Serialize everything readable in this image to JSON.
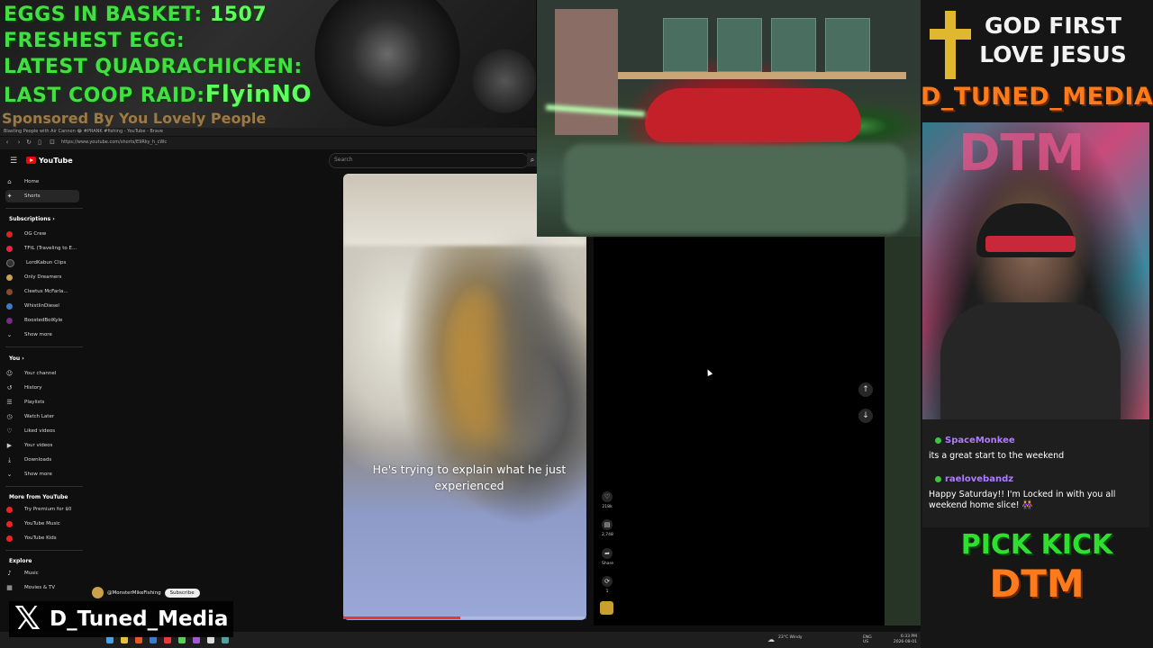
{
  "overlay": {
    "eggs_label": "EGGS IN BASKET:",
    "eggs_value": "1507",
    "freshest_label": "FRESHEST EGG:",
    "freshest_value": "",
    "quadrachicken_label": "LATEST QUADRACHICKEN:",
    "quadrachicken_value": "",
    "raid_label": "LAST COOP RAID:",
    "raid_value": "FlyinNO",
    "sponsor": "Sponsored By You Lovely People"
  },
  "browser": {
    "title": "Blasting People with Air Cannon 😂 #PRANK #fishing - YouTube - Brave",
    "url": "https://www.youtube.com/shorts/E9Rky_h_cWc"
  },
  "youtube": {
    "logo_text": "YouTube",
    "search_placeholder": "Search",
    "sidebar": {
      "home": "Home",
      "shorts": "Shorts",
      "subscriptions_header": "Subscriptions",
      "subs": [
        {
          "label": "OG Crew",
          "color": "#d22"
        },
        {
          "label": "TFtL (Traveling to E...",
          "color": "#e24"
        },
        {
          "label": "LordKabun Clips",
          "color": "#333"
        },
        {
          "label": "Only Dreamers",
          "color": "#c9a24a"
        },
        {
          "label": "Cleetus McFarla...",
          "color": "#8a4a2a"
        },
        {
          "label": "WhistlinDiesel",
          "color": "#3a7ac8"
        },
        {
          "label": "BoostedBoiKyle",
          "color": "#7a2a8a"
        }
      ],
      "show_more_1": "Show more",
      "you_header": "You",
      "you_items": [
        "Your channel",
        "History",
        "Playlists",
        "Watch Later",
        "Liked videos",
        "Your videos",
        "Downloads"
      ],
      "show_more_2": "Show more",
      "more_header": "More from YouTube",
      "more_items": [
        "Try Premium for $0",
        "YouTube Music",
        "YouTube Kids"
      ],
      "explore_header": "Explore",
      "explore_items": [
        "Music",
        "Movies & TV"
      ]
    },
    "short": {
      "caption": "He's trying to explain what he just experienced",
      "channel": "@MonsterMikeFishing",
      "subscribe": "Subscribe",
      "likes": "218k",
      "comments": "2,748",
      "share": "Share",
      "remix": "1",
      "progress": 0.48
    }
  },
  "right_panel": {
    "line1": "GOD FIRST",
    "line2": "LOVE JESUS",
    "brand": "D_TUNED_MEDIA",
    "chat": [
      {
        "user": "SpaceMonkee",
        "message": "its a great start to the weekend"
      },
      {
        "user": "raelovebandz",
        "message": "Happy Saturday!! I'm Locked in with you all weekend home slice! 👭"
      }
    ],
    "pick": "PICK KICK",
    "dtm": "DTM"
  },
  "taskbar": {
    "weather": "23°C Windy",
    "lang": "ENG US",
    "time": "6:33 PM",
    "date": "2026-08-01"
  },
  "x_handle": "D_Tuned_Media"
}
